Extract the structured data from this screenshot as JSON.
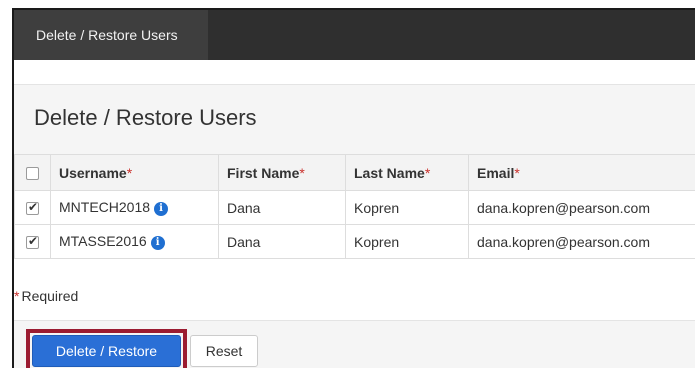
{
  "nav": {
    "tab_label": "Delete / Restore Users"
  },
  "page": {
    "title": "Delete / Restore Users"
  },
  "table": {
    "columns": {
      "username": "Username",
      "first_name": "First Name",
      "last_name": "Last Name",
      "email": "Email",
      "required_mark": "*"
    },
    "rows": [
      {
        "checked": true,
        "username": "MNTECH2018",
        "first_name": "Dana",
        "last_name": "Kopren",
        "email": "dana.kopren@pearson.com"
      },
      {
        "checked": true,
        "username": "MTASSE2016",
        "first_name": "Dana",
        "last_name": "Kopren",
        "email": "dana.kopren@pearson.com"
      }
    ]
  },
  "required_note": {
    "mark": "*",
    "text": "Required"
  },
  "actions": {
    "primary_label": "Delete / Restore",
    "secondary_label": "Reset"
  },
  "colors": {
    "topbar": "#2f2f2f",
    "primary_button": "#2a6fd6",
    "highlight_border": "#9b1c31",
    "required": "#c9302c",
    "info_icon": "#1f6fd1"
  },
  "icons": {
    "row_info": "info-circle-icon"
  }
}
